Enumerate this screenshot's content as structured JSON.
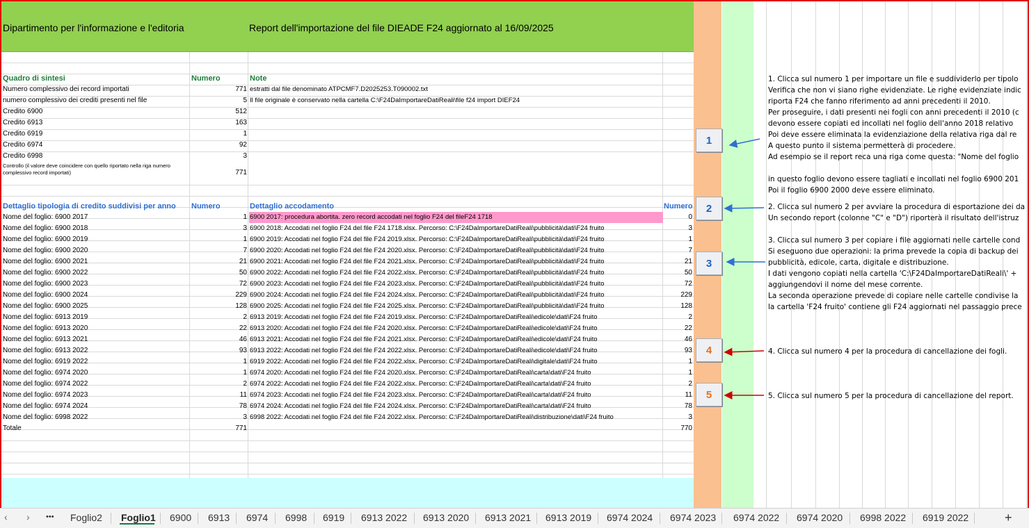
{
  "header": {
    "dept": "Dipartimento per l'informazione e l'editoria",
    "report": "Report dell'importazione del file DIEADE F24 aggiornato al 16/09/2025"
  },
  "summary": {
    "col_title": "Quadro di sintesi",
    "col_numero": "Numero",
    "col_note": "Note",
    "rows": [
      {
        "label": "Numero complessivo dei record importati",
        "value": "771",
        "note": "estratti dal file denominato ATPCMF7.D2025253.T090002.txt"
      },
      {
        "label": "numero complessivo dei crediti presenti nel file",
        "value": "5",
        "note": "Il file originale è conservato nella cartella C:\\F24DaImportareDatiReali\\file f24 import DIEF24"
      },
      {
        "label": "Credito 6900",
        "value": "512",
        "note": ""
      },
      {
        "label": "Credito 6913",
        "value": "163",
        "note": ""
      },
      {
        "label": "Credito 6919",
        "value": "1",
        "note": ""
      },
      {
        "label": "Credito 6974",
        "value": "92",
        "note": ""
      },
      {
        "label": "Credito 6998",
        "value": "3",
        "note": ""
      }
    ],
    "control_label": "Controllo (il valore deve coincidere con quello riportato nella riga numero complessivo record importati)",
    "control_value": "771"
  },
  "detail": {
    "col_title": "Dettaglio tipologia di credito suddivisi per anno",
    "col_numero": "Numero",
    "col_accodamento": "Dettaglio accodamento",
    "col_numero2": "Numero",
    "rows": [
      {
        "label": "Nome del foglio: 6900 2017",
        "n": "1",
        "desc": "6900 2017: procedura abortita. zero record accodati nel foglio F24 del fileF24 1718",
        "n2": "0",
        "pink": true
      },
      {
        "label": "Nome del foglio: 6900 2018",
        "n": "3",
        "desc": "6900 2018: Accodati nel foglio F24 del file F24 1718.xlsx. Percorso: C:\\F24DaImportareDatiReali\\pubblicità\\dati\\F24 fruito",
        "n2": "3"
      },
      {
        "label": "Nome del foglio: 6900 2019",
        "n": "1",
        "desc": "6900 2019: Accodati nel foglio F24 del file F24 2019.xlsx. Percorso: C:\\F24DaImportareDatiReali\\pubblicità\\dati\\F24 fruito",
        "n2": "1"
      },
      {
        "label": "Nome del foglio: 6900 2020",
        "n": "7",
        "desc": "6900 2020: Accodati nel foglio F24 del file F24 2020.xlsx. Percorso: C:\\F24DaImportareDatiReali\\pubblicità\\dati\\F24 fruito",
        "n2": "7"
      },
      {
        "label": "Nome del foglio: 6900 2021",
        "n": "21",
        "desc": "6900 2021: Accodati nel foglio F24 del file F24 2021.xlsx. Percorso: C:\\F24DaImportareDatiReali\\pubblicità\\dati\\F24 fruito",
        "n2": "21"
      },
      {
        "label": "Nome del foglio: 6900 2022",
        "n": "50",
        "desc": "6900 2022: Accodati nel foglio F24 del file F24 2022.xlsx. Percorso: C:\\F24DaImportareDatiReali\\pubblicità\\dati\\F24 fruito",
        "n2": "50"
      },
      {
        "label": "Nome del foglio: 6900 2023",
        "n": "72",
        "desc": "6900 2023: Accodati nel foglio F24 del file F24 2023.xlsx. Percorso: C:\\F24DaImportareDatiReali\\pubblicità\\dati\\F24 fruito",
        "n2": "72"
      },
      {
        "label": "Nome del foglio: 6900 2024",
        "n": "229",
        "desc": "6900 2024: Accodati nel foglio F24 del file F24 2024.xlsx. Percorso: C:\\F24DaImportareDatiReali\\pubblicità\\dati\\F24 fruito",
        "n2": "229"
      },
      {
        "label": "Nome del foglio: 6900 2025",
        "n": "128",
        "desc": "6900 2025: Accodati nel foglio F24 del file F24 2025.xlsx. Percorso: C:\\F24DaImportareDatiReali\\pubblicità\\dati\\F24 fruito",
        "n2": "128"
      },
      {
        "label": "Nome del foglio: 6913 2019",
        "n": "2",
        "desc": "6913 2019: Accodati nel foglio F24 del file F24 2019.xlsx. Percorso: C:\\F24DaImportareDatiReali\\edicole\\dati\\F24 fruito",
        "n2": "2"
      },
      {
        "label": "Nome del foglio: 6913 2020",
        "n": "22",
        "desc": "6913 2020: Accodati nel foglio F24 del file F24 2020.xlsx. Percorso: C:\\F24DaImportareDatiReali\\edicole\\dati\\F24 fruito",
        "n2": "22"
      },
      {
        "label": "Nome del foglio: 6913 2021",
        "n": "46",
        "desc": "6913 2021: Accodati nel foglio F24 del file F24 2021.xlsx. Percorso: C:\\F24DaImportareDatiReali\\edicole\\dati\\F24 fruito",
        "n2": "46"
      },
      {
        "label": "Nome del foglio: 6913 2022",
        "n": "93",
        "desc": "6913 2022: Accodati nel foglio F24 del file F24 2022.xlsx. Percorso: C:\\F24DaImportareDatiReali\\edicole\\dati\\F24 fruito",
        "n2": "93"
      },
      {
        "label": "Nome del foglio: 6919 2022",
        "n": "1",
        "desc": "6919 2022: Accodati nel foglio F24 del file F24 2022.xlsx. Percorso: C:\\F24DaImportareDatiReali\\digitale\\dati\\F24 fruito",
        "n2": "1"
      },
      {
        "label": "Nome del foglio: 6974 2020",
        "n": "1",
        "desc": "6974 2020: Accodati nel foglio F24 del file F24 2020.xlsx. Percorso: C:\\F24DaImportareDatiReali\\carta\\dati\\F24 fruito",
        "n2": "1"
      },
      {
        "label": "Nome del foglio: 6974 2022",
        "n": "2",
        "desc": "6974 2022: Accodati nel foglio F24 del file F24 2022.xlsx. Percorso: C:\\F24DaImportareDatiReali\\carta\\dati\\F24 fruito",
        "n2": "2"
      },
      {
        "label": "Nome del foglio: 6974 2023",
        "n": "11",
        "desc": "6974 2023: Accodati nel foglio F24 del file F24 2023.xlsx. Percorso: C:\\F24DaImportareDatiReali\\carta\\dati\\F24 fruito",
        "n2": "11"
      },
      {
        "label": "Nome del foglio: 6974 2024",
        "n": "78",
        "desc": "6974 2024: Accodati nel foglio F24 del file F24 2024.xlsx. Percorso: C:\\F24DaImportareDatiReali\\carta\\dati\\F24 fruito",
        "n2": "78"
      },
      {
        "label": "Nome del foglio: 6998 2022",
        "n": "3",
        "desc": "6998 2022: Accodati nel foglio F24 del file F24 2022.xlsx. Percorso: C:\\F24DaImportareDatiReali\\distribuzione\\dati\\F24 fruito",
        "n2": "3"
      }
    ],
    "total_label": "Totale",
    "total_value": "771",
    "total_value2": "770"
  },
  "buttons": [
    "1",
    "2",
    "3",
    "4",
    "5"
  ],
  "instructions": {
    "step1": [
      "1. Clicca sul numero 1 per importare un file e suddividerlo per tipolo",
      "Verifica che non vi siano righe evidenziate. Le righe evidenziate indic",
      "riporta F24 che fanno riferimento ad anni precedenti il 2010.",
      "Per proseguire, i dati presenti nei fogli con anni precedenti il 2010 (c",
      "devono essere copiati ed incollati nel foglio dell'anno 2018 relativo",
      "Poi deve essere eliminata la evidenziazione della relativa riga dal re",
      " A questo punto il sistema permetterà di procedere.",
      "Ad esempio se il report reca una riga come questa: \"Nome del foglio",
      "",
      "in questo foglio devono essere tagliati e incollati nel foglio 6900 201",
      "Poi il foglio 6900 2000 deve essere eliminato."
    ],
    "step2": [
      "2. Clicca sul numero 2 per avviare la procedura di esportazione dei da",
      "Un secondo report (colonne \"C\" e \"D\") riporterà il risultato dell'istruz"
    ],
    "step3": [
      "3. Clicca sul numero 3 per copiare i file aggiornati nelle cartelle cond",
      "Si eseguono due operazioni: la prima prevede la copia di backup dei",
      "pubblicità, edicole, carta, digitale e distribuzione.",
      "I dati vengono copiati nella cartella 'C:\\F24DaImportareDatiReali\\' +",
      "aggiungendovi il nome del mese corrente.",
      "La seconda operazione prevede di copiare nelle cartelle condivise la",
      "la cartella 'F24 fruito' contiene gli F24 aggiornati nel passaggio prece"
    ],
    "step4": "4. Clicca sul numero 4 per la procedura di cancellazione dei fogli.",
    "step5": "5. Clicca sul numero 5 per la procedura di cancellazione del report."
  },
  "tabs": {
    "more": "•••",
    "items": [
      "Foglio2",
      "Foglio1",
      "6900",
      "6913",
      "6974",
      "6998",
      "6919",
      "6913 2022",
      "6913 2020",
      "6913 2021",
      "6913 2019",
      "6974 2024",
      "6974 2023",
      "6974 2022",
      "6974 2020",
      "6998 2022",
      "6919 2022"
    ],
    "active": "Foglio1",
    "add": "+"
  },
  "colors": {
    "header_green": "#92d050",
    "orange_column": "#fac090",
    "green_column": "#ccffcc",
    "highlight_pink": "#ff99cc",
    "frame_red": "#e00000",
    "arrow_blue": "#2f6fd1",
    "arrow_red": "#d00000"
  }
}
